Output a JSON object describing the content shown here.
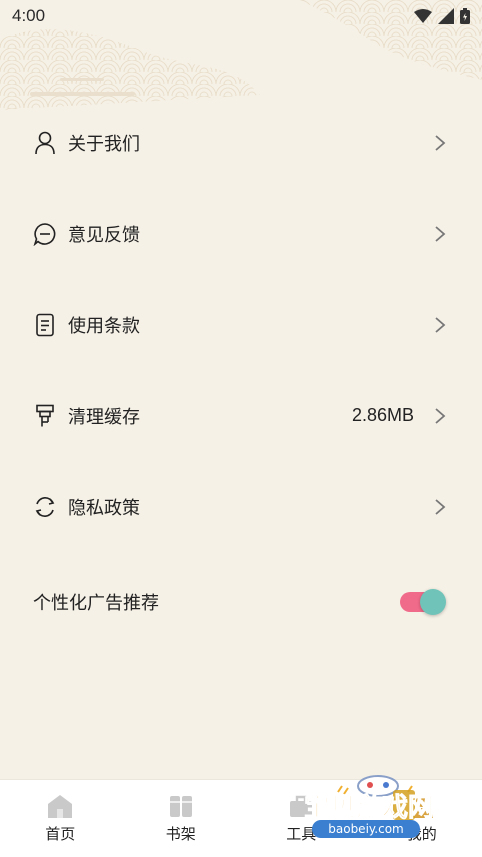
{
  "status_bar": {
    "time": "4:00",
    "icons": [
      "wifi-icon",
      "signal-icon",
      "battery-icon"
    ]
  },
  "menu": {
    "items": [
      {
        "label": "关于我们",
        "icon": "person-icon",
        "value": ""
      },
      {
        "label": "意见反馈",
        "icon": "feedback-icon",
        "value": ""
      },
      {
        "label": "使用条款",
        "icon": "document-icon",
        "value": ""
      },
      {
        "label": "清理缓存",
        "icon": "brush-icon",
        "value": "2.86MB"
      },
      {
        "label": "隐私政策",
        "icon": "refresh-icon",
        "value": ""
      }
    ]
  },
  "personalized_ads": {
    "label": "个性化广告推荐",
    "enabled": true
  },
  "bottom_nav": {
    "items": [
      {
        "label": "首页",
        "icon": "home-icon"
      },
      {
        "label": "书架",
        "icon": "bookshelf-icon"
      },
      {
        "label": "工具",
        "icon": "toolbox-icon"
      },
      {
        "label": "我的",
        "icon": "profile-icon"
      }
    ]
  },
  "watermark": {
    "text": "宝贝游戏网",
    "domain": "baobeiy.com"
  },
  "colors": {
    "background": "#f6f1e7",
    "toggle_track": "#f06b8a",
    "toggle_knob": "#6fc3b8"
  }
}
